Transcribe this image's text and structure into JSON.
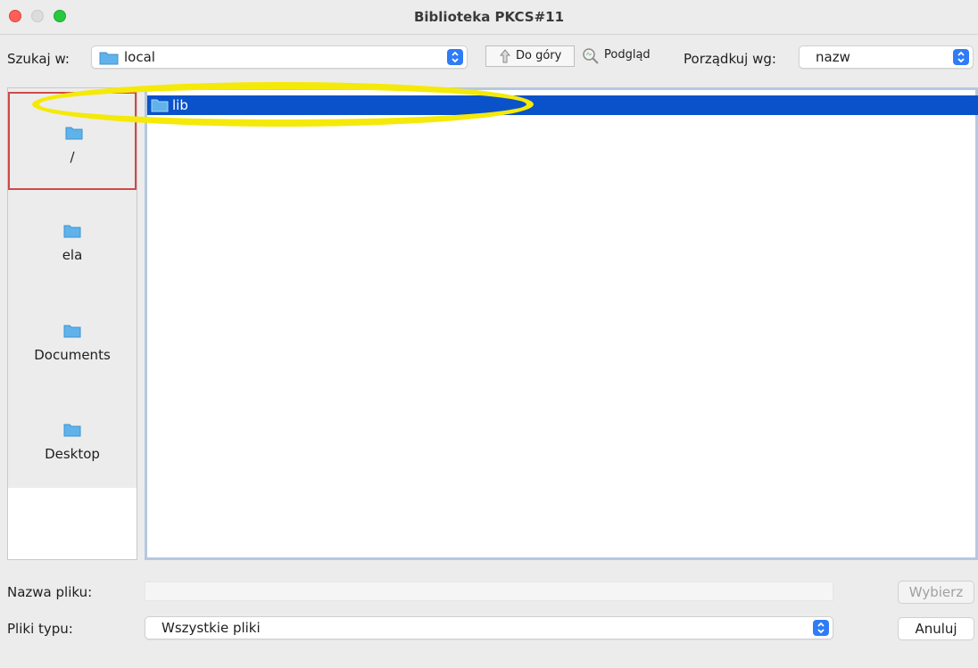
{
  "window": {
    "title": "Biblioteka PKCS#11"
  },
  "toolbar": {
    "look_in_label": "Szukaj w:",
    "look_in_value": "local",
    "up_button": "Do góry",
    "preview_button": "Podgląd",
    "sort_label": "Porządkuj wg:",
    "sort_value": "nazw"
  },
  "sidebar": {
    "places": [
      {
        "label": "/",
        "selected": true,
        "icon": "folder-icon"
      },
      {
        "label": "ela",
        "selected": false,
        "icon": "folder-icon"
      },
      {
        "label": "Documents",
        "selected": false,
        "icon": "folder-icon"
      },
      {
        "label": "Desktop",
        "selected": false,
        "icon": "folder-icon"
      }
    ]
  },
  "files": [
    {
      "name": "lib",
      "selected": true,
      "icon": "folder-icon"
    }
  ],
  "footer": {
    "filename_label": "Nazwa pliku:",
    "filename_value": "",
    "filetype_label": "Pliki typu:",
    "filetype_value": "Wszystkie pliki",
    "choose_button": "Wybierz",
    "cancel_button": "Anuluj"
  },
  "colors": {
    "selection": "#0a52c9",
    "folder": "#5fb3ea",
    "highlight": "#f5e90a",
    "accent": "#2f7cf6"
  }
}
